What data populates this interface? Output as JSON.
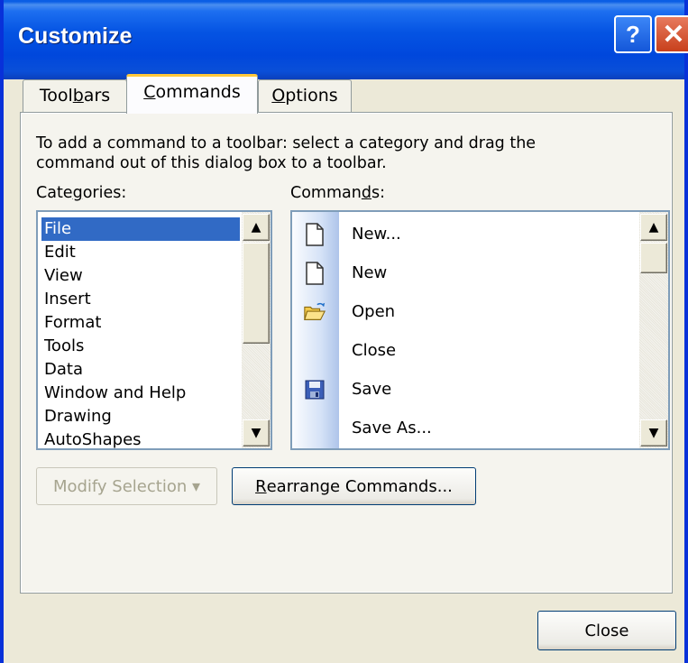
{
  "window": {
    "title": "Customize",
    "help_glyph": "?",
    "close_glyph": "✕"
  },
  "tabs": [
    {
      "label_pre": "Tool",
      "label_accel": "b",
      "label_post": "ars"
    },
    {
      "label_pre": "",
      "label_accel": "C",
      "label_post": "ommands"
    },
    {
      "label_pre": "",
      "label_accel": "O",
      "label_post": "ptions"
    }
  ],
  "instructions": "To add a command to a toolbar: select a category and drag the command out of this dialog box to a toolbar.",
  "categories": {
    "label_pre": "Cate",
    "label_accel": "g",
    "label_post": "ories:",
    "items": [
      "File",
      "Edit",
      "View",
      "Insert",
      "Format",
      "Tools",
      "Data",
      "Window and Help",
      "Drawing",
      "AutoShapes"
    ],
    "selected": "File"
  },
  "commands": {
    "label_pre": "Comman",
    "label_accel": "d",
    "label_post": "s:",
    "items": [
      {
        "label": "New...",
        "icon": "new-document-icon"
      },
      {
        "label": "New",
        "icon": "new-document-icon"
      },
      {
        "label": "Open",
        "icon": "open-folder-icon"
      },
      {
        "label": "Close",
        "icon": ""
      },
      {
        "label": "Save",
        "icon": "save-disk-icon"
      },
      {
        "label": "Save As...",
        "icon": ""
      }
    ]
  },
  "buttons": {
    "modify_selection": "Modify Selection",
    "modify_arrow": "▾",
    "rearrange_pre": "",
    "rearrange_accel": "R",
    "rearrange_post": "earrange Commands...",
    "close": "Close"
  },
  "scroll_glyphs": {
    "up": "▲",
    "down": "▼"
  },
  "colors": {
    "selection": "#316ac5",
    "titlebar": "#0554e3",
    "dialog_bg": "#ece9d8",
    "tab_highlight": "#ffc83c"
  }
}
